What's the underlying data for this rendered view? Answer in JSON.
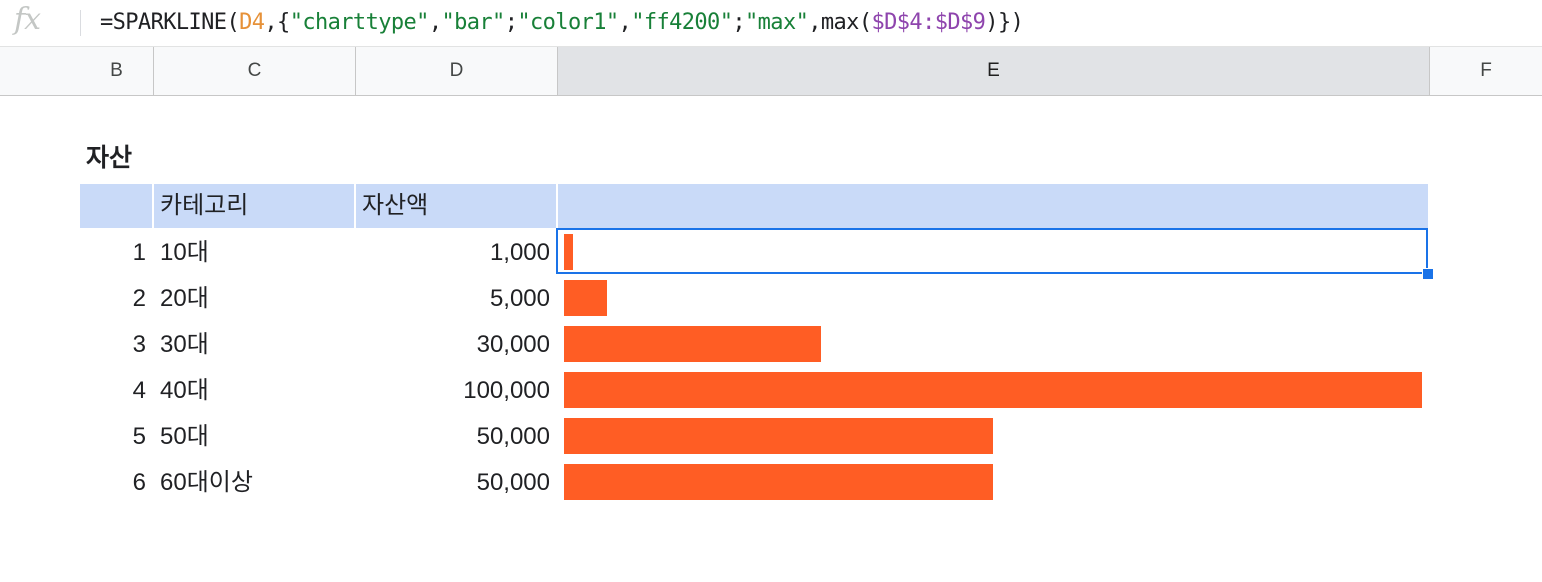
{
  "formula_bar": {
    "fx_label": "fx",
    "formula_tokens": [
      {
        "text": "=SPARKLINE(",
        "kind": "fn"
      },
      {
        "text": "D4",
        "kind": "ref"
      },
      {
        "text": ",{",
        "kind": "fn"
      },
      {
        "text": "\"charttype\"",
        "kind": "str"
      },
      {
        "text": ",",
        "kind": "fn"
      },
      {
        "text": "\"bar\"",
        "kind": "str"
      },
      {
        "text": ";",
        "kind": "fn"
      },
      {
        "text": "\"color1\"",
        "kind": "str"
      },
      {
        "text": ",",
        "kind": "fn"
      },
      {
        "text": "\"ff4200\"",
        "kind": "str"
      },
      {
        "text": ";",
        "kind": "fn"
      },
      {
        "text": "\"max\"",
        "kind": "str"
      },
      {
        "text": ",max(",
        "kind": "fn"
      },
      {
        "text": "$D$4:$D$9",
        "kind": "rng"
      },
      {
        "text": ")})",
        "kind": "fn"
      }
    ]
  },
  "columns": [
    "B",
    "C",
    "D",
    "E",
    "F"
  ],
  "selected_column": "E",
  "sheet": {
    "title": "자산",
    "headers": {
      "category": "카테고리",
      "amount": "자산액",
      "bar": ""
    },
    "rows": [
      {
        "index": "1",
        "category": "10대",
        "amount": "1,000",
        "value": 1000
      },
      {
        "index": "2",
        "category": "20대",
        "amount": "5,000",
        "value": 5000
      },
      {
        "index": "3",
        "category": "30대",
        "amount": "30,000",
        "value": 30000
      },
      {
        "index": "4",
        "category": "40대",
        "amount": "100,000",
        "value": 100000
      },
      {
        "index": "5",
        "category": "50대",
        "amount": "50,000",
        "value": 50000
      },
      {
        "index": "6",
        "category": "60대이상",
        "amount": "50,000",
        "value": 50000
      }
    ],
    "bar_color": "#ff4200",
    "bar_max": 100000,
    "header_fill": "#c9daf8",
    "selection_color": "#1a73e8"
  }
}
